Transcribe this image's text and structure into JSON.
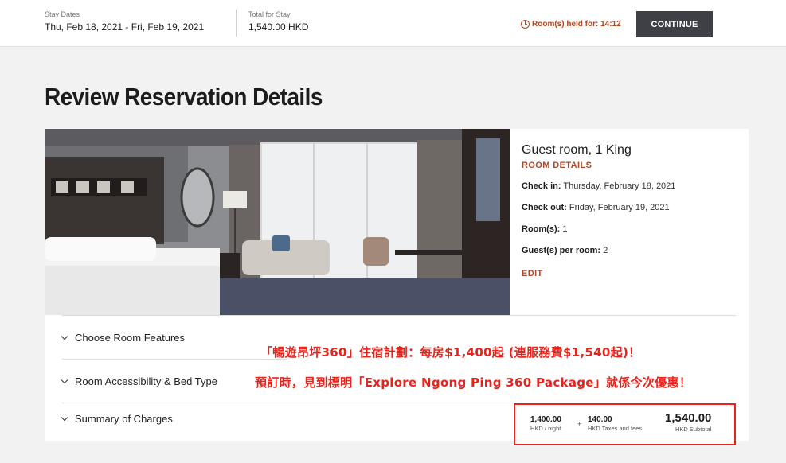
{
  "header": {
    "stay_dates_label": "Stay Dates",
    "stay_dates_value": "Thu, Feb 18, 2021 - Fri, Feb 19, 2021",
    "total_label": "Total for Stay",
    "total_value": "1,540.00 HKD",
    "held_text": "Room(s) held for: 14:12",
    "continue_label": "CONTINUE"
  },
  "page_title": "Review Reservation Details",
  "room": {
    "title": "Guest room, 1 King",
    "details_link": "ROOM DETAILS",
    "checkin_label": "Check in:",
    "checkin_value": "Thursday, February 18, 2021",
    "checkout_label": "Check out:",
    "checkout_value": "Friday, February 19, 2021",
    "rooms_label": "Room(s):",
    "rooms_value": "1",
    "guests_label": "Guest(s) per room:",
    "guests_value": "2",
    "edit_label": "EDIT"
  },
  "accordions": [
    {
      "label": "Choose Room Features"
    },
    {
      "label": "Room Accessibility & Bed Type"
    },
    {
      "label": "Summary of Charges"
    }
  ],
  "promo": {
    "line1": "「暢遊昂坪360」住宿計劃：每房$1,400起 (連服務費$1,540起)！",
    "line2": "預訂時，見到標明「Explore Ngong Ping 360 Package」就係今次優惠！"
  },
  "charges": {
    "per_night_value": "1,400.00",
    "per_night_label": "HKD / night",
    "plus": "+",
    "taxes_value": "140.00",
    "taxes_label": "HKD Taxes and fees",
    "subtotal_value": "1,540.00",
    "subtotal_label": "HKD Subtotal"
  },
  "colors": {
    "accent": "#a84a2b",
    "button": "#3f3f46",
    "promo_red": "#e8231c"
  }
}
